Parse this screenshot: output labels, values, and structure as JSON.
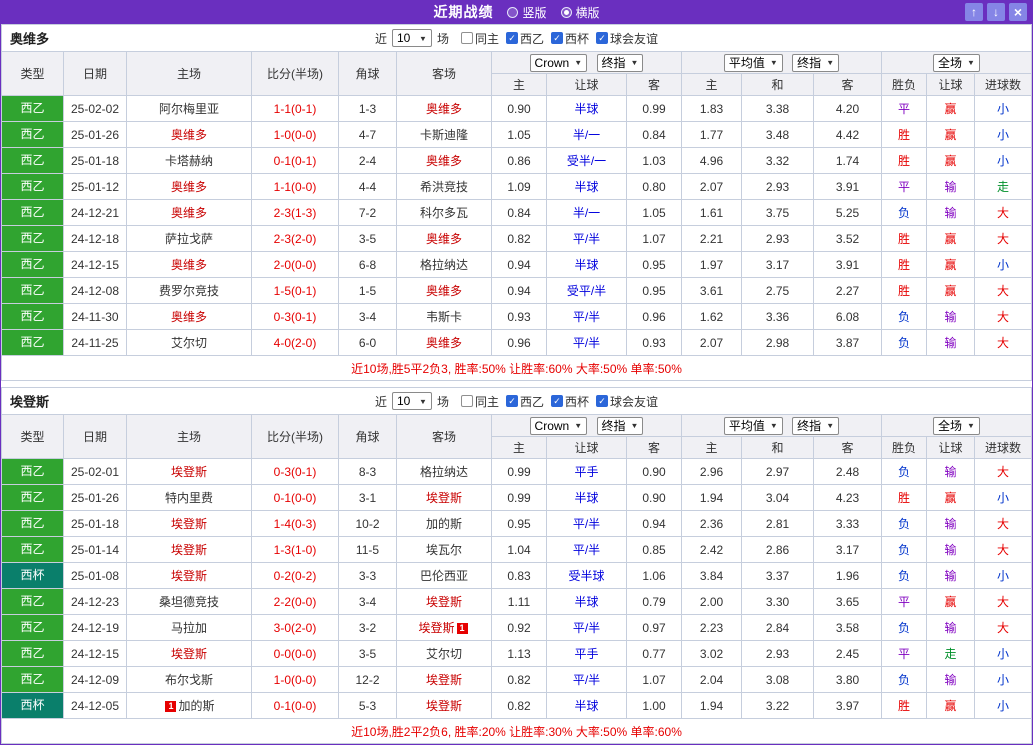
{
  "titlebar": {
    "title": "近期战绩",
    "radios": [
      {
        "label": "竖版",
        "selected": false
      },
      {
        "label": "横版",
        "selected": true
      }
    ]
  },
  "controls": {
    "near_label": "近",
    "count_value": "10",
    "games_label": "场",
    "checkboxes": [
      {
        "label": "同主",
        "checked": false
      },
      {
        "label": "西乙",
        "checked": true
      },
      {
        "label": "西杯",
        "checked": true
      },
      {
        "label": "球会友谊",
        "checked": true
      }
    ],
    "odds_company": "Crown",
    "odds_stage": "终指",
    "avg_label": "平均值",
    "avg_stage": "终指",
    "scope": "全场"
  },
  "table_headers": {
    "type": "类型",
    "date": "日期",
    "home": "主场",
    "score": "比分(半场)",
    "corner": "角球",
    "away": "客场",
    "odds_home": "主",
    "odds_handicap": "让球",
    "odds_away": "客",
    "avg_home": "主",
    "avg_draw": "和",
    "avg_away": "客",
    "result_wdl": "胜负",
    "result_handicap": "让球",
    "result_goals": "进球数"
  },
  "colors": {
    "titlebar_purple": "#6a2fbf",
    "league_green": "#30a430",
    "cup_teal": "#0a7f6b",
    "focus_red": "#c80000",
    "handicap_blue": "#0000dd"
  },
  "sections": [
    {
      "team": "奥维多",
      "summary": "近10场,胜5平2负3, 胜率:50% 让胜率:60% 大率:50% 单率:50%",
      "rows": [
        {
          "league": "西乙",
          "is_cup": false,
          "date": "25-02-02",
          "home": "阿尔梅里亚",
          "home_focus": false,
          "home_card": 0,
          "score": "1-1(0-1)",
          "corner": "1-3",
          "away": "奥维多",
          "away_focus": true,
          "away_card": 0,
          "o_home": "0.90",
          "handicap": "半球",
          "o_away": "0.99",
          "a_home": "1.83",
          "a_draw": "3.38",
          "a_away": "4.20",
          "r_wdl": "平",
          "r_handicap": "赢",
          "r_goals": "小"
        },
        {
          "league": "西乙",
          "is_cup": false,
          "date": "25-01-26",
          "home": "奥维多",
          "home_focus": true,
          "home_card": 0,
          "score": "1-0(0-0)",
          "corner": "4-7",
          "away": "卡斯迪隆",
          "away_focus": false,
          "away_card": 0,
          "o_home": "1.05",
          "handicap": "半/一",
          "o_away": "0.84",
          "a_home": "1.77",
          "a_draw": "3.48",
          "a_away": "4.42",
          "r_wdl": "胜",
          "r_handicap": "赢",
          "r_goals": "小"
        },
        {
          "league": "西乙",
          "is_cup": false,
          "date": "25-01-18",
          "home": "卡塔赫纳",
          "home_focus": false,
          "home_card": 0,
          "score": "0-1(0-1)",
          "corner": "2-4",
          "away": "奥维多",
          "away_focus": true,
          "away_card": 0,
          "o_home": "0.86",
          "handicap": "受半/一",
          "o_away": "1.03",
          "a_home": "4.96",
          "a_draw": "3.32",
          "a_away": "1.74",
          "r_wdl": "胜",
          "r_handicap": "赢",
          "r_goals": "小"
        },
        {
          "league": "西乙",
          "is_cup": false,
          "date": "25-01-12",
          "home": "奥维多",
          "home_focus": true,
          "home_card": 0,
          "score": "1-1(0-0)",
          "corner": "4-4",
          "away": "希洪竞技",
          "away_focus": false,
          "away_card": 0,
          "o_home": "1.09",
          "handicap": "半球",
          "o_away": "0.80",
          "a_home": "2.07",
          "a_draw": "2.93",
          "a_away": "3.91",
          "r_wdl": "平",
          "r_handicap": "输",
          "r_goals": "走"
        },
        {
          "league": "西乙",
          "is_cup": false,
          "date": "24-12-21",
          "home": "奥维多",
          "home_focus": true,
          "home_card": 0,
          "score": "2-3(1-3)",
          "corner": "7-2",
          "away": "科尔多瓦",
          "away_focus": false,
          "away_card": 0,
          "o_home": "0.84",
          "handicap": "半/一",
          "o_away": "1.05",
          "a_home": "1.61",
          "a_draw": "3.75",
          "a_away": "5.25",
          "r_wdl": "负",
          "r_handicap": "输",
          "r_goals": "大"
        },
        {
          "league": "西乙",
          "is_cup": false,
          "date": "24-12-18",
          "home": "萨拉戈萨",
          "home_focus": false,
          "home_card": 0,
          "score": "2-3(2-0)",
          "corner": "3-5",
          "away": "奥维多",
          "away_focus": true,
          "away_card": 0,
          "o_home": "0.82",
          "handicap": "平/半",
          "o_away": "1.07",
          "a_home": "2.21",
          "a_draw": "2.93",
          "a_away": "3.52",
          "r_wdl": "胜",
          "r_handicap": "赢",
          "r_goals": "大"
        },
        {
          "league": "西乙",
          "is_cup": false,
          "date": "24-12-15",
          "home": "奥维多",
          "home_focus": true,
          "home_card": 0,
          "score": "2-0(0-0)",
          "corner": "6-8",
          "away": "格拉纳达",
          "away_focus": false,
          "away_card": 0,
          "o_home": "0.94",
          "handicap": "半球",
          "o_away": "0.95",
          "a_home": "1.97",
          "a_draw": "3.17",
          "a_away": "3.91",
          "r_wdl": "胜",
          "r_handicap": "赢",
          "r_goals": "小"
        },
        {
          "league": "西乙",
          "is_cup": false,
          "date": "24-12-08",
          "home": "费罗尔竞技",
          "home_focus": false,
          "home_card": 0,
          "score": "1-5(0-1)",
          "corner": "1-5",
          "away": "奥维多",
          "away_focus": true,
          "away_card": 0,
          "o_home": "0.94",
          "handicap": "受平/半",
          "o_away": "0.95",
          "a_home": "3.61",
          "a_draw": "2.75",
          "a_away": "2.27",
          "r_wdl": "胜",
          "r_handicap": "赢",
          "r_goals": "大"
        },
        {
          "league": "西乙",
          "is_cup": false,
          "date": "24-11-30",
          "home": "奥维多",
          "home_focus": true,
          "home_card": 0,
          "score": "0-3(0-1)",
          "corner": "3-4",
          "away": "韦斯卡",
          "away_focus": false,
          "away_card": 0,
          "o_home": "0.93",
          "handicap": "平/半",
          "o_away": "0.96",
          "a_home": "1.62",
          "a_draw": "3.36",
          "a_away": "6.08",
          "r_wdl": "负",
          "r_handicap": "输",
          "r_goals": "大"
        },
        {
          "league": "西乙",
          "is_cup": false,
          "date": "24-11-25",
          "home": "艾尔切",
          "home_focus": false,
          "home_card": 0,
          "score": "4-0(2-0)",
          "corner": "6-0",
          "away": "奥维多",
          "away_focus": true,
          "away_card": 0,
          "o_home": "0.96",
          "handicap": "平/半",
          "o_away": "0.93",
          "a_home": "2.07",
          "a_draw": "2.98",
          "a_away": "3.87",
          "r_wdl": "负",
          "r_handicap": "输",
          "r_goals": "大"
        }
      ]
    },
    {
      "team": "埃登斯",
      "summary": "近10场,胜2平2负6, 胜率:20% 让胜率:30% 大率:50% 单率:60%",
      "rows": [
        {
          "league": "西乙",
          "is_cup": false,
          "date": "25-02-01",
          "home": "埃登斯",
          "home_focus": true,
          "home_card": 0,
          "score": "0-3(0-1)",
          "corner": "8-3",
          "away": "格拉纳达",
          "away_focus": false,
          "away_card": 0,
          "o_home": "0.99",
          "handicap": "平手",
          "o_away": "0.90",
          "a_home": "2.96",
          "a_draw": "2.97",
          "a_away": "2.48",
          "r_wdl": "负",
          "r_handicap": "输",
          "r_goals": "大"
        },
        {
          "league": "西乙",
          "is_cup": false,
          "date": "25-01-26",
          "home": "特内里费",
          "home_focus": false,
          "home_card": 0,
          "score": "0-1(0-0)",
          "corner": "3-1",
          "away": "埃登斯",
          "away_focus": true,
          "away_card": 0,
          "o_home": "0.99",
          "handicap": "半球",
          "o_away": "0.90",
          "a_home": "1.94",
          "a_draw": "3.04",
          "a_away": "4.23",
          "r_wdl": "胜",
          "r_handicap": "赢",
          "r_goals": "小"
        },
        {
          "league": "西乙",
          "is_cup": false,
          "date": "25-01-18",
          "home": "埃登斯",
          "home_focus": true,
          "home_card": 0,
          "score": "1-4(0-3)",
          "corner": "10-2",
          "away": "加的斯",
          "away_focus": false,
          "away_card": 0,
          "o_home": "0.95",
          "handicap": "平/半",
          "o_away": "0.94",
          "a_home": "2.36",
          "a_draw": "2.81",
          "a_away": "3.33",
          "r_wdl": "负",
          "r_handicap": "输",
          "r_goals": "大"
        },
        {
          "league": "西乙",
          "is_cup": false,
          "date": "25-01-14",
          "home": "埃登斯",
          "home_focus": true,
          "home_card": 0,
          "score": "1-3(1-0)",
          "corner": "11-5",
          "away": "埃瓦尔",
          "away_focus": false,
          "away_card": 0,
          "o_home": "1.04",
          "handicap": "平/半",
          "o_away": "0.85",
          "a_home": "2.42",
          "a_draw": "2.86",
          "a_away": "3.17",
          "r_wdl": "负",
          "r_handicap": "输",
          "r_goals": "大"
        },
        {
          "league": "西杯",
          "is_cup": true,
          "date": "25-01-08",
          "home": "埃登斯",
          "home_focus": true,
          "home_card": 0,
          "score": "0-2(0-2)",
          "corner": "3-3",
          "away": "巴伦西亚",
          "away_focus": false,
          "away_card": 0,
          "o_home": "0.83",
          "handicap": "受半球",
          "o_away": "1.06",
          "a_home": "3.84",
          "a_draw": "3.37",
          "a_away": "1.96",
          "r_wdl": "负",
          "r_handicap": "输",
          "r_goals": "小"
        },
        {
          "league": "西乙",
          "is_cup": false,
          "date": "24-12-23",
          "home": "桑坦德竞技",
          "home_focus": false,
          "home_card": 0,
          "score": "2-2(0-0)",
          "corner": "3-4",
          "away": "埃登斯",
          "away_focus": true,
          "away_card": 0,
          "o_home": "1.11",
          "handicap": "半球",
          "o_away": "0.79",
          "a_home": "2.00",
          "a_draw": "3.30",
          "a_away": "3.65",
          "r_wdl": "平",
          "r_handicap": "赢",
          "r_goals": "大"
        },
        {
          "league": "西乙",
          "is_cup": false,
          "date": "24-12-19",
          "home": "马拉加",
          "home_focus": false,
          "home_card": 0,
          "score": "3-0(2-0)",
          "corner": "3-2",
          "away": "埃登斯",
          "away_focus": true,
          "away_card": 1,
          "o_home": "0.92",
          "handicap": "平/半",
          "o_away": "0.97",
          "a_home": "2.23",
          "a_draw": "2.84",
          "a_away": "3.58",
          "r_wdl": "负",
          "r_handicap": "输",
          "r_goals": "大"
        },
        {
          "league": "西乙",
          "is_cup": false,
          "date": "24-12-15",
          "home": "埃登斯",
          "home_focus": true,
          "home_card": 0,
          "score": "0-0(0-0)",
          "corner": "3-5",
          "away": "艾尔切",
          "away_focus": false,
          "away_card": 0,
          "o_home": "1.13",
          "handicap": "平手",
          "o_away": "0.77",
          "a_home": "3.02",
          "a_draw": "2.93",
          "a_away": "2.45",
          "r_wdl": "平",
          "r_handicap": "走",
          "r_goals": "小"
        },
        {
          "league": "西乙",
          "is_cup": false,
          "date": "24-12-09",
          "home": "布尔戈斯",
          "home_focus": false,
          "home_card": 0,
          "score": "1-0(0-0)",
          "corner": "12-2",
          "away": "埃登斯",
          "away_focus": true,
          "away_card": 0,
          "o_home": "0.82",
          "handicap": "平/半",
          "o_away": "1.07",
          "a_home": "2.04",
          "a_draw": "3.08",
          "a_away": "3.80",
          "r_wdl": "负",
          "r_handicap": "输",
          "r_goals": "小"
        },
        {
          "league": "西杯",
          "is_cup": true,
          "date": "24-12-05",
          "home": "加的斯",
          "home_focus": false,
          "home_card": 1,
          "score": "0-1(0-0)",
          "corner": "5-3",
          "away": "埃登斯",
          "away_focus": true,
          "away_card": 0,
          "o_home": "0.82",
          "handicap": "半球",
          "o_away": "1.00",
          "a_home": "1.94",
          "a_draw": "3.22",
          "a_away": "3.97",
          "r_wdl": "胜",
          "r_handicap": "赢",
          "r_goals": "小"
        }
      ]
    }
  ]
}
